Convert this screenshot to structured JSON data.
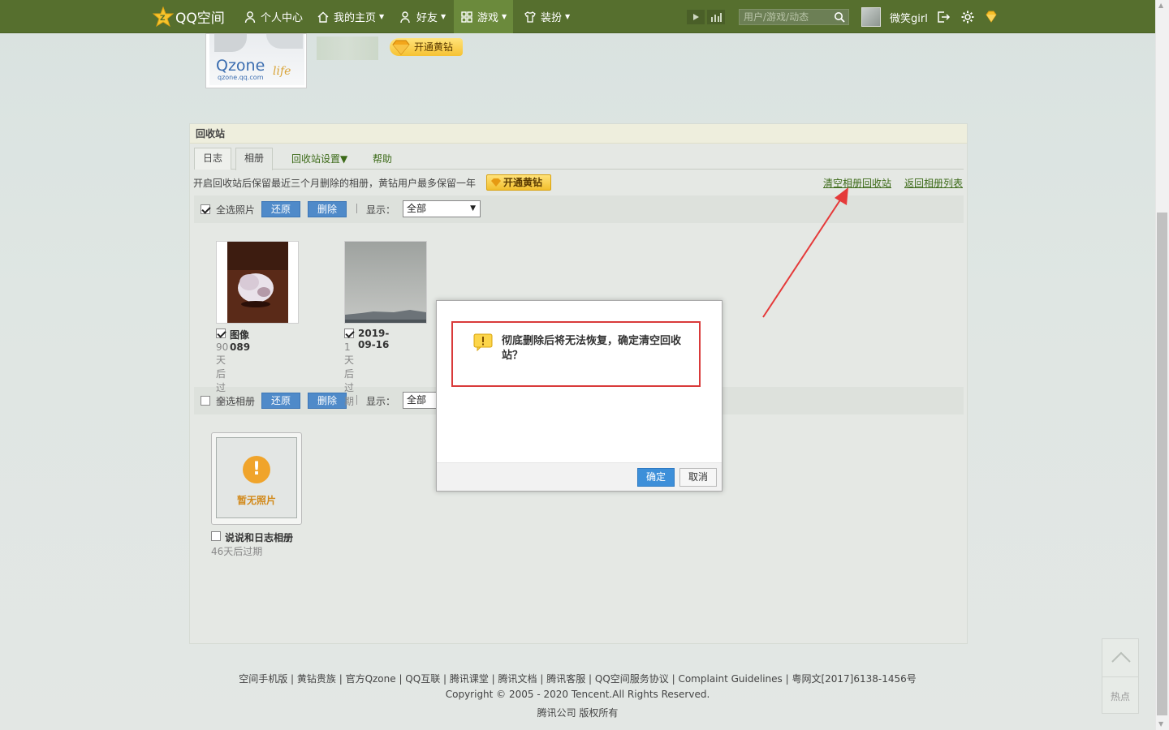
{
  "nav": {
    "logo_text": "QQ空间",
    "items": [
      {
        "label": "个人中心"
      },
      {
        "label": "我的主页"
      },
      {
        "label": "好友"
      },
      {
        "label": "游戏"
      },
      {
        "label": "装扮"
      }
    ],
    "search_placeholder": "用户/游戏/动态",
    "username": "微笑girl"
  },
  "header": {
    "avatar_brand": "Qzone",
    "avatar_url": "qzone.qq.com",
    "avatar_life": "life",
    "vip_button": "开通黄钻"
  },
  "panel": {
    "title": "回收站",
    "tabs": [
      {
        "label": "日志"
      },
      {
        "label": "相册"
      }
    ],
    "settings_link": "回收站设置▼",
    "help_link": "帮助",
    "notice": "开启回收站后保留最近三个月删除的相册，黄钻用户最多保留一年",
    "notice_vip_button": "开通黄钻",
    "clear_link": "清空相册回收站",
    "back_link": "返回相册列表"
  },
  "photo_toolbar": {
    "select_all_label": "全选照片",
    "restore": "还原",
    "delete": "删除",
    "show_label": "显示：",
    "show_value": "全部"
  },
  "photos": [
    {
      "name": "图像089",
      "expire": "90天后过期"
    },
    {
      "name": "2019-09-16",
      "expire": "1天后过期"
    }
  ],
  "album_toolbar": {
    "select_all_label": "全选相册",
    "restore": "还原",
    "delete": "删除",
    "show_label": "显示：",
    "show_value": "全部"
  },
  "albums": [
    {
      "placeholder": "暂无照片",
      "name": "说说和日志相册",
      "expire": "46天后过期"
    }
  ],
  "dialog": {
    "message": "彻底删除后将无法恢复，确定清空回收站？",
    "ok": "确定",
    "cancel": "取消"
  },
  "footer": {
    "links": "空间手机版 | 黄钻贵族 | 官方Qzone | QQ互联 | 腾讯课堂 | 腾讯文档 | 腾讯客服 | QQ空间服务协议 | Complaint Guidelines | 粤网文[2017]6138-1456号",
    "copyright": "Copyright © 2005 - 2020 Tencent.All Rights Reserved.",
    "company": "腾讯公司 版权所有"
  },
  "float_widget": {
    "label": "热点"
  },
  "colors": {
    "nav_bg": "#566f2e",
    "accent_blue": "#4f8ac9",
    "annotation_red": "#d93a3a"
  }
}
